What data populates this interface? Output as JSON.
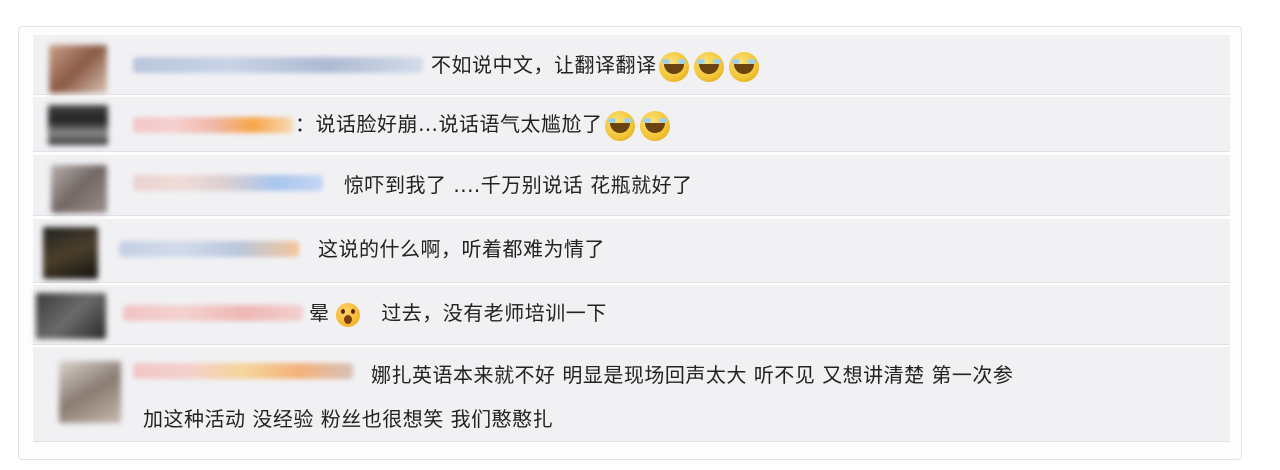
{
  "comments": [
    {
      "text": "不如说中文，让翻译翻译",
      "emojis": [
        "laugh-cry-emoji",
        "laugh-cry-emoji",
        "laugh-cry-emoji"
      ]
    },
    {
      "text": "：说话脸好崩…说话语气太尴尬了",
      "emojis": [
        "laugh-cry-emoji",
        "laugh-cry-emoji"
      ]
    },
    {
      "text": "惊吓到我了 ....千万别说话 花瓶就好了",
      "emojis": []
    },
    {
      "text": "这说的什么啊，听着都难为情了",
      "emojis": []
    },
    {
      "text": "晕",
      "text2": "过去，没有老师培训一下",
      "emojis": [
        "shocked-emoji"
      ]
    },
    {
      "text": "娜扎英语本来就不好 明显是现场回声太大 听不见 又想讲清楚 第一次参",
      "text_line2": "加这种活动 没经验 粉丝也很想笑 我们憨憨扎",
      "emojis": []
    }
  ],
  "colors": {
    "row_bg": "#f1f1f4",
    "text": "#222222"
  }
}
